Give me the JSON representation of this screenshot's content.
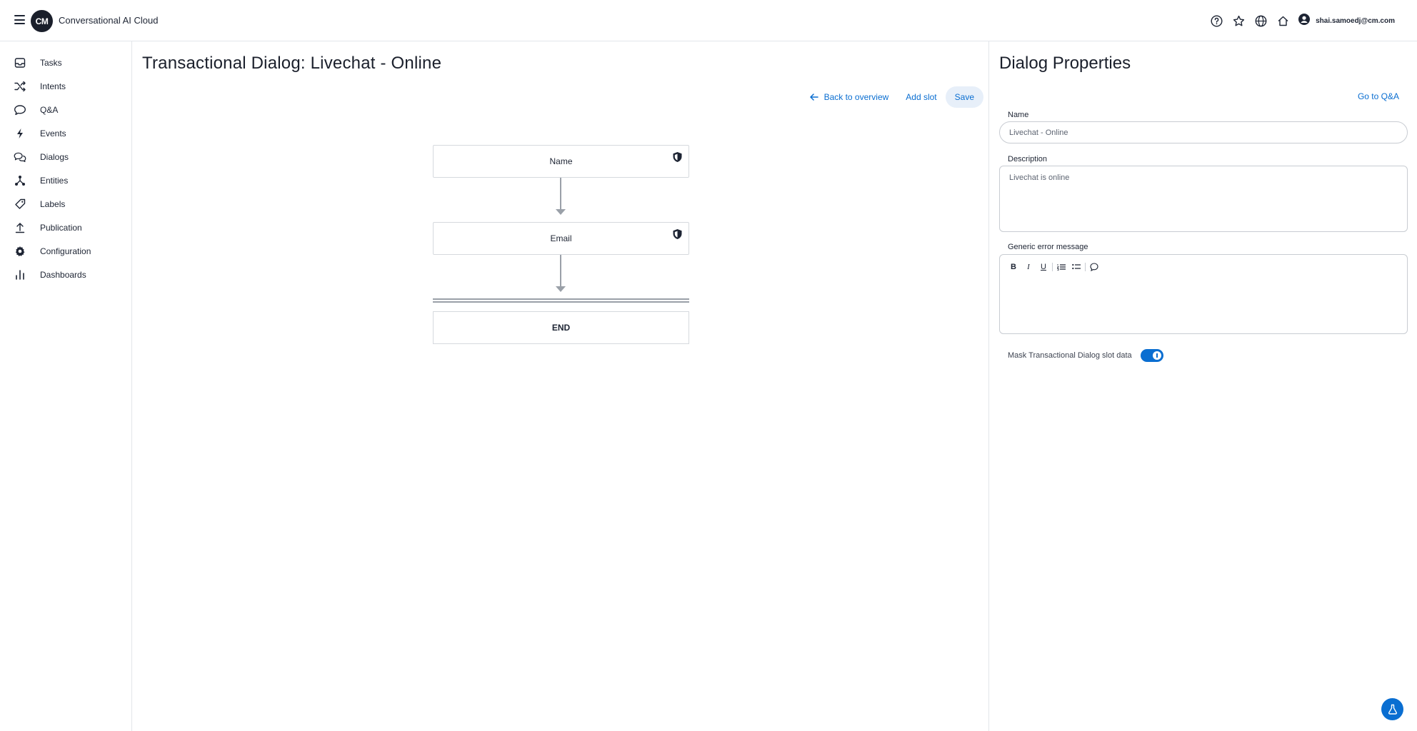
{
  "header": {
    "logo_text": "CM",
    "app_title": "Conversational AI Cloud",
    "user_email": "shai.samoedj@cm.com",
    "icons": [
      "help-icon",
      "star-icon",
      "globe-icon",
      "home-icon",
      "user-icon"
    ]
  },
  "sidebar": {
    "items": [
      {
        "label": "Tasks",
        "icon": "inbox-icon"
      },
      {
        "label": "Intents",
        "icon": "shuffle-icon"
      },
      {
        "label": "Q&A",
        "icon": "speech-bubble-icon"
      },
      {
        "label": "Events",
        "icon": "lightning-icon"
      },
      {
        "label": "Dialogs",
        "icon": "dialogs-icon"
      },
      {
        "label": "Entities",
        "icon": "entities-icon"
      },
      {
        "label": "Labels",
        "icon": "tag-icon"
      },
      {
        "label": "Publication",
        "icon": "upload-icon"
      },
      {
        "label": "Configuration",
        "icon": "gear-icon"
      },
      {
        "label": "Dashboards",
        "icon": "bar-chart-icon"
      }
    ]
  },
  "main": {
    "title": "Transactional Dialog: Livechat - Online",
    "actions": {
      "back_label": "Back to overview",
      "add_slot_label": "Add slot",
      "save_label": "Save"
    },
    "slots": [
      {
        "label": "Name",
        "protected": true
      },
      {
        "label": "Email",
        "protected": true
      }
    ],
    "end_label": "END"
  },
  "panel": {
    "title": "Dialog Properties",
    "go_to_qa_label": "Go to Q&A",
    "name_label": "Name",
    "name_value": "Livechat - Online",
    "description_label": "Description",
    "description_value": "Livechat is online",
    "error_label": "Generic error message",
    "error_value": "",
    "toolbar": {
      "bold": "B",
      "italic": "I",
      "underline": "U"
    },
    "mask_label": "Mask Transactional Dialog slot data",
    "mask_enabled": true
  },
  "colors": {
    "accent": "#0a6ed1",
    "text": "#1a1f2b",
    "border": "#d6d9de",
    "connector": "#9aa0a8"
  }
}
